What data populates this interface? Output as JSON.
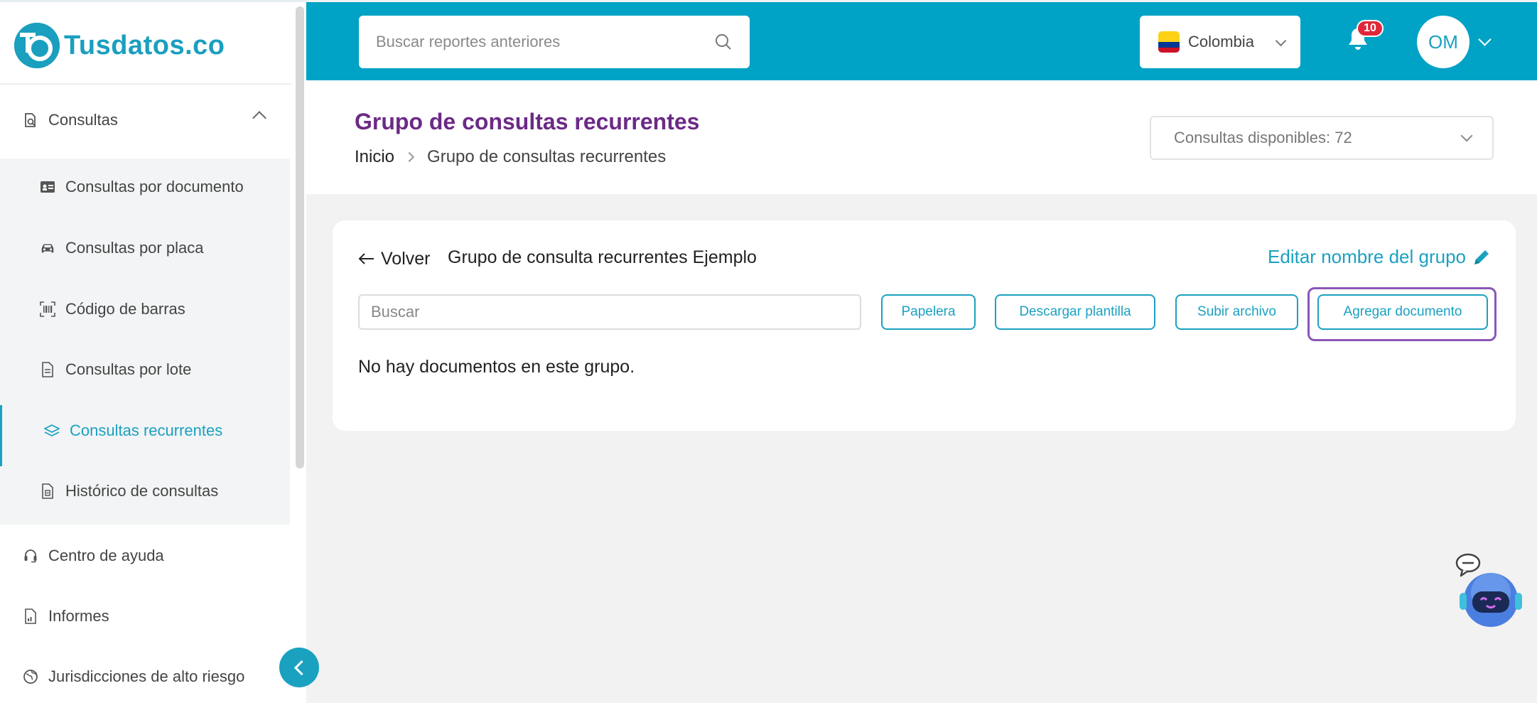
{
  "brand": {
    "name": "Tusdatos.co",
    "logo_glyph": "TD",
    "color": "#1a9fbf"
  },
  "sidebar": {
    "parent": {
      "label": "Consultas",
      "icon": "search-document-icon",
      "expanded": true
    },
    "subitems": [
      {
        "label": "Consultas por documento",
        "icon": "id-card-icon",
        "active": false
      },
      {
        "label": "Consultas por placa",
        "icon": "car-icon",
        "active": false
      },
      {
        "label": "Código de barras",
        "icon": "barcode-icon",
        "active": false
      },
      {
        "label": "Consultas por lote",
        "icon": "file-icon",
        "active": false
      },
      {
        "label": "Consultas recurrentes",
        "icon": "layers-icon",
        "active": true
      },
      {
        "label": "Histórico de consultas",
        "icon": "file-history-icon",
        "active": false
      }
    ],
    "items": [
      {
        "label": "Centro de ayuda",
        "icon": "headset-icon"
      },
      {
        "label": "Informes",
        "icon": "report-icon"
      },
      {
        "label": "Jurisdicciones de alto riesgo",
        "icon": "globe-icon"
      }
    ]
  },
  "topbar": {
    "search_placeholder": "Buscar reportes anteriores",
    "country": "Colombia",
    "notifications_count": "10",
    "user_initials": "OM",
    "color": "#00a2c5"
  },
  "page": {
    "title": "Grupo de consultas recurrentes",
    "breadcrumb_home": "Inicio",
    "breadcrumb_current": "Grupo de consultas recurrentes",
    "available": "Consultas disponibles: 72"
  },
  "card": {
    "back_label": "Volver",
    "group_name": "Grupo de consulta recurrentes Ejemplo",
    "edit_label": "Editar nombre del grupo",
    "search_placeholder": "Buscar",
    "buttons": {
      "trash": "Papelera",
      "download_template": "Descargar plantilla",
      "upload_file": "Subir archivo",
      "add_document": "Agregar documento"
    },
    "empty_message": "No hay documentos en este grupo."
  }
}
